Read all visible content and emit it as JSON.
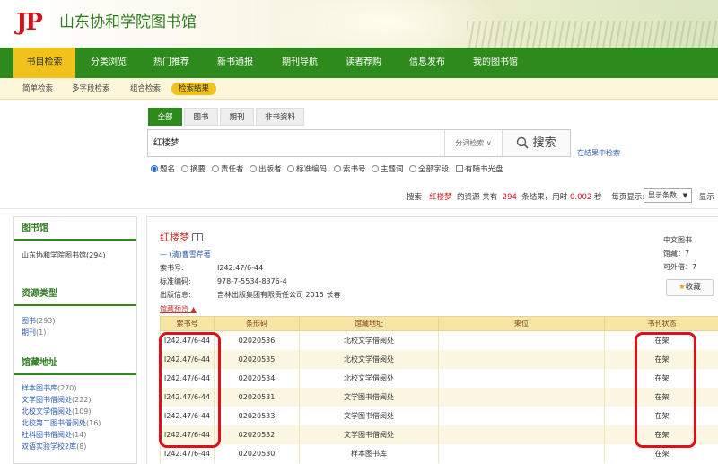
{
  "header": {
    "logo": "JP",
    "title": "山东协和学院图书馆"
  },
  "mainnav": [
    {
      "label": "书目检索",
      "active": true
    },
    {
      "label": "分类浏览"
    },
    {
      "label": "热门推荐"
    },
    {
      "label": "新书通报"
    },
    {
      "label": "期刊导航"
    },
    {
      "label": "读者荐购"
    },
    {
      "label": "信息发布"
    },
    {
      "label": "我的图书馆"
    }
  ],
  "subnav": [
    {
      "label": "简单检索"
    },
    {
      "label": "多字段检索"
    },
    {
      "label": "组合检索"
    },
    {
      "label": "检索结果",
      "active": true
    }
  ],
  "search": {
    "tabs": [
      {
        "label": "全部",
        "active": true
      },
      {
        "label": "图书"
      },
      {
        "label": "期刊"
      },
      {
        "label": "非书资料"
      }
    ],
    "value": "红楼梦",
    "scope": "分词检索",
    "button": "搜索",
    "advanced_link": "在结果中检索",
    "fields": [
      {
        "label": "题名",
        "checked": true
      },
      {
        "label": "摘要"
      },
      {
        "label": "责任者"
      },
      {
        "label": "出版者"
      },
      {
        "label": "标准编码"
      },
      {
        "label": "索书号"
      },
      {
        "label": "主题词"
      },
      {
        "label": "全部字段"
      }
    ],
    "cd_only": "有随书光盘"
  },
  "summary": {
    "prefix": "搜索",
    "keyword": "红楼梦",
    "mid": "的资源 共有",
    "count": "294",
    "unit": "条结果，用时",
    "time": "0.002",
    "time_unit": "秒",
    "perpage_label": "每页显示:",
    "perpage_value": "显示条数",
    "cut": "显示"
  },
  "sidebar": {
    "library": {
      "title": "图书馆",
      "items": [
        {
          "label": "山东协和学院图书馆",
          "count": "(294)"
        }
      ]
    },
    "restype": {
      "title": "资源类型",
      "items": [
        {
          "label": "图书",
          "count": "(293)"
        },
        {
          "label": "期刊",
          "count": "(1)"
        }
      ]
    },
    "location": {
      "title": "馆藏地址",
      "items": [
        {
          "label": "样本图书库",
          "count": "(270)"
        },
        {
          "label": "文学图书借阅处",
          "count": "(222)"
        },
        {
          "label": "北校文学借阅处",
          "count": "(109)"
        },
        {
          "label": "北校第二图书借阅处",
          "count": "(16)"
        },
        {
          "label": "社科图书借阅处",
          "count": "(14)"
        },
        {
          "label": "双语实验学校2库",
          "count": "(8)"
        }
      ]
    }
  },
  "result": {
    "title": "红楼梦",
    "author": "(清)曹雪芹著",
    "meta": [
      {
        "k": "索书号:",
        "v": "I242.47/6-44"
      },
      {
        "k": "标准编码:",
        "v": "978-7-5534-8376-4"
      },
      {
        "k": "出版信息:",
        "v": "吉林出版集团有限责任公司  2015  长春"
      }
    ],
    "holdings_link": "馆藏预览 ▲",
    "type": "中文图书",
    "holdings_count": "馆藏：7",
    "available": "可外借：7",
    "collect": "收藏"
  },
  "table": {
    "headers": [
      "索书号",
      "条形码",
      "馆藏地址",
      "架位",
      "书刊状态"
    ],
    "rows": [
      [
        "I242.47/6-44",
        "02020536",
        "北校文学借阅处",
        "",
        "在架"
      ],
      [
        "I242.47/6-44",
        "02020535",
        "北校文学借阅处",
        "",
        "在架"
      ],
      [
        "I242.47/6-44",
        "02020534",
        "北校文学借阅处",
        "",
        "在架"
      ],
      [
        "I242.47/6-44",
        "02020531",
        "文学图书借阅处",
        "",
        "在架"
      ],
      [
        "I242.47/6-44",
        "02020533",
        "文学图书借阅处",
        "",
        "在架"
      ],
      [
        "I242.47/6-44",
        "02020532",
        "文学图书借阅处",
        "",
        "在架"
      ],
      [
        "I242.47/6-44",
        "02020530",
        "样本图书库",
        "",
        "在架"
      ]
    ]
  },
  "colors": {
    "nav_green": "#2e8a1c",
    "nav_active": "#f1c21b",
    "highlight_red": "#e0101b",
    "table_header": "#f6e6a6"
  }
}
